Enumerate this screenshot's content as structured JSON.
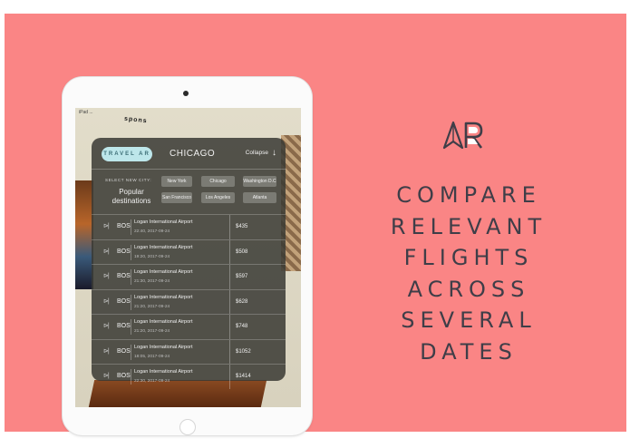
{
  "colors": {
    "background": "#fa8585",
    "tagline": "#3f3e48",
    "brand_badge": "#bde6ea",
    "panel": "#3a3a34"
  },
  "device_scene": {
    "status_text": "iPad ...",
    "doodle_text": "spons"
  },
  "panel": {
    "brand": "TRAVEL AR",
    "city": "CHICAGO",
    "collapse_label": "Collapse",
    "collapse_icon": "down-arrow-icon",
    "select_label": "SELECT NEW CITY:",
    "popular_label": "Popular destinations",
    "destinations": [
      "New York",
      "Chicago",
      "Washington D.C",
      "San Francisco",
      "Los Angeles",
      "Atlanta"
    ]
  },
  "flights": [
    {
      "code": "BOS",
      "airport": "Logan International Airport",
      "time": "22:40, 2017-09-24",
      "price": "$435"
    },
    {
      "code": "BOS",
      "airport": "Logan International Airport",
      "time": "19:20, 2017-09-24",
      "price": "$508"
    },
    {
      "code": "BOS",
      "airport": "Logan International Airport",
      "time": "21:30, 2017-09-24",
      "price": "$597"
    },
    {
      "code": "BOS",
      "airport": "Logan International Airport",
      "time": "21:20, 2017-09-24",
      "price": "$628"
    },
    {
      "code": "BOS",
      "airport": "Logan International Airport",
      "time": "21:20, 2017-09-24",
      "price": "$748"
    },
    {
      "code": "BOS",
      "airport": "Logan International Airport",
      "time": "18:05, 2017-09-24",
      "price": "$1052"
    },
    {
      "code": "BOS",
      "airport": "Logan International Airport",
      "time": "22:30, 2017-09-24",
      "price": "$1414"
    }
  ],
  "tagline": [
    "COMPARE",
    "RELEVANT",
    "FLIGHTS",
    "ACROSS",
    "SEVERAL",
    "DATES"
  ],
  "logo_icon": "ar-logo-icon"
}
